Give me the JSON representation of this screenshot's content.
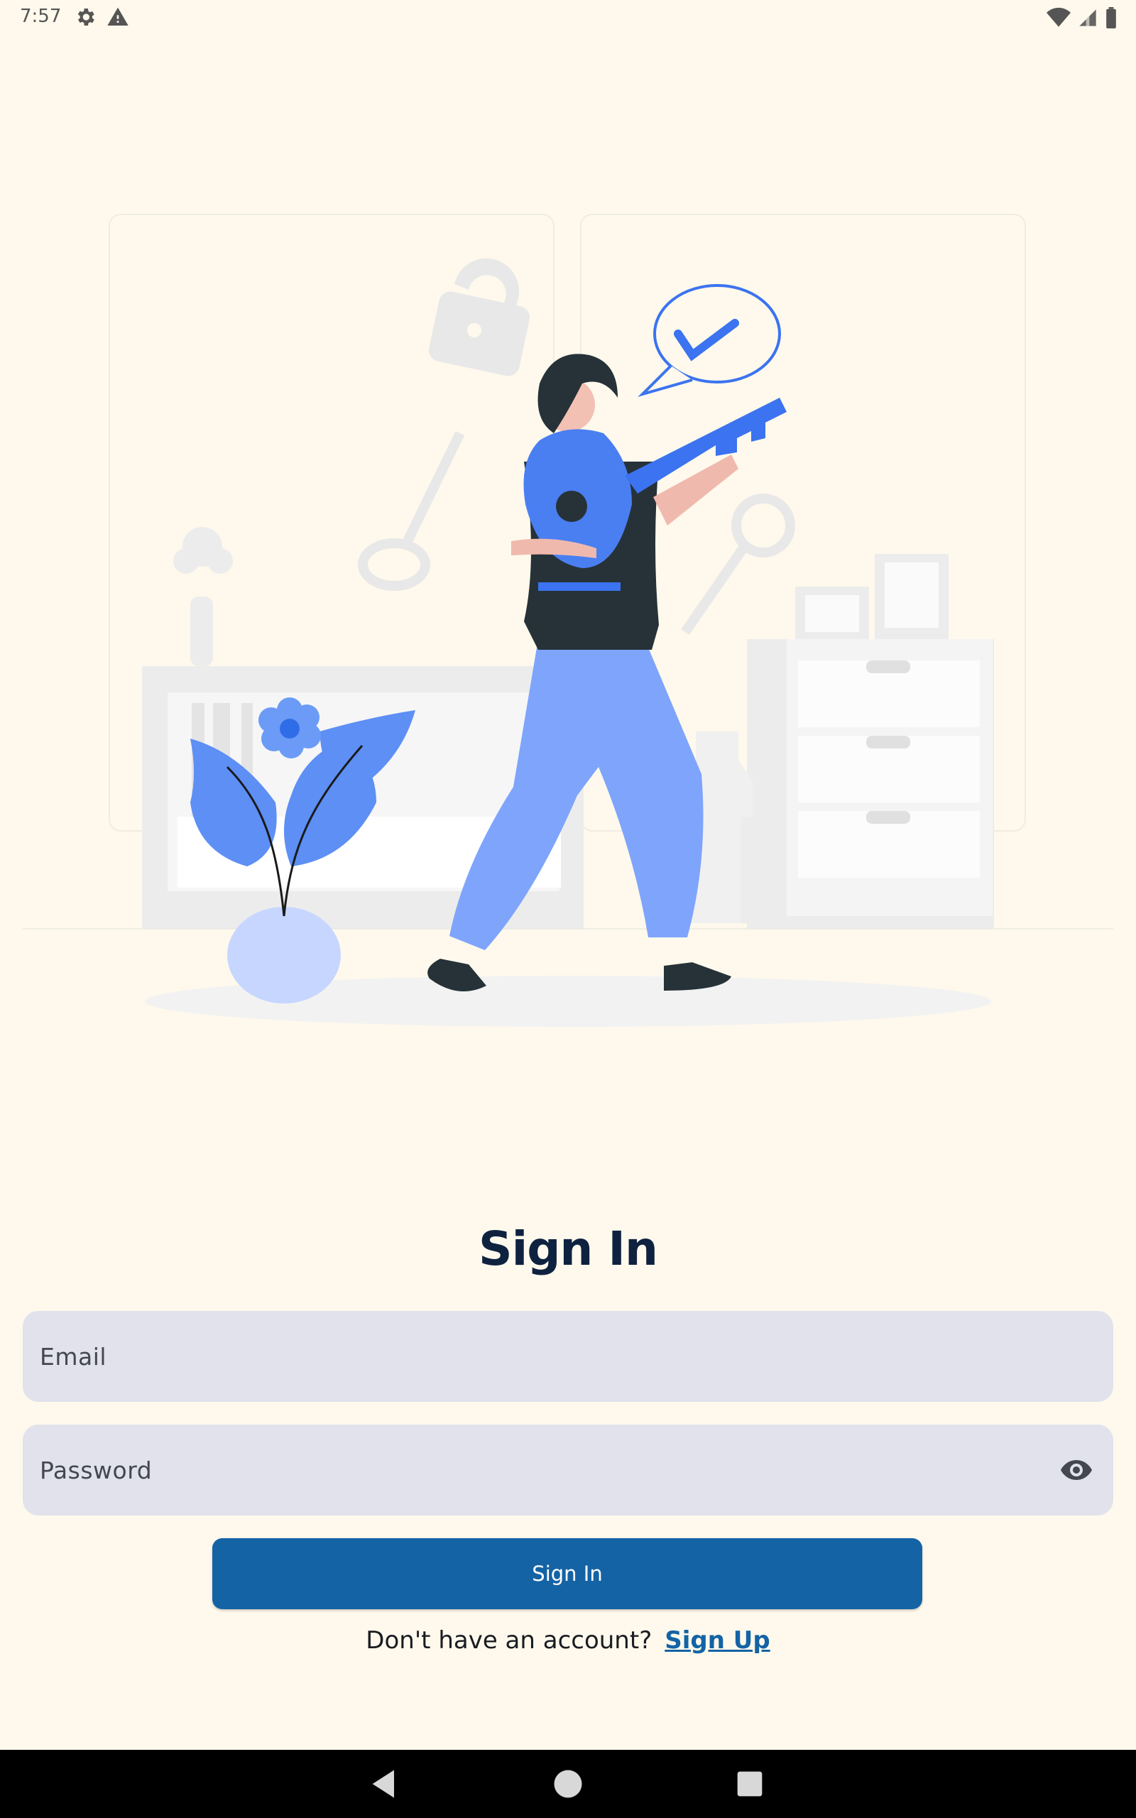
{
  "status_bar": {
    "time": "7:57",
    "left_icons": [
      "settings-icon",
      "warning-icon"
    ],
    "right_icons": [
      "wifi-icon",
      "signal-icon",
      "battery-icon"
    ]
  },
  "illustration": {
    "description_icon": "key-illustration",
    "accent_color": "#3b73f0"
  },
  "form": {
    "title": "Sign In",
    "email_placeholder": "Email",
    "password_placeholder": "Password",
    "password_toggle_icon": "eye-icon",
    "submit_label": "Sign In"
  },
  "signup": {
    "prompt": "Don't have an account?",
    "link_label": "Sign Up"
  },
  "nav_bar": {
    "buttons": [
      "back-icon",
      "home-icon",
      "recents-icon"
    ]
  },
  "colors": {
    "background": "#fef9ec",
    "field_bg": "#e1e2ec",
    "primary": "#1463a5",
    "title": "#0e2240"
  }
}
